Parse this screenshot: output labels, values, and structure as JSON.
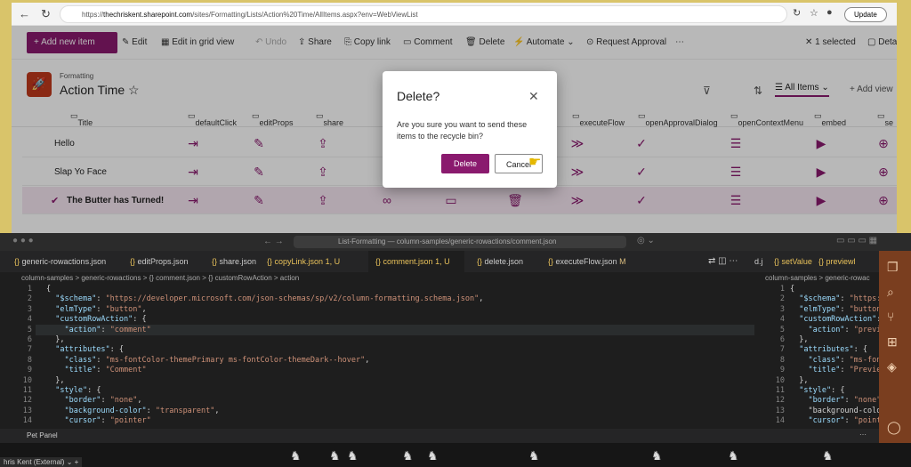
{
  "browser": {
    "url_prefix": "https://",
    "url_host": "thechriskent.sharepoint.com",
    "url_path": "/sites/Formatting/Lists/Action%20Time/AllItems.aspx?env=WebViewList",
    "update_label": "Update"
  },
  "sharepoint": {
    "commands": [
      "Add new item",
      "Edit",
      "Edit in grid view",
      "Undo",
      "Share",
      "Copy link",
      "Comment",
      "Delete",
      "Automate",
      "Request Approval",
      "1 selected",
      "Details"
    ],
    "site_label": "Formatting",
    "list_title": "Action Time",
    "view_label": "All Items",
    "add_view": "Add view",
    "columns": [
      "Title",
      "defaultClick",
      "editProps",
      "share",
      "executeFlow",
      "openApprovalDialog",
      "openContextMenu",
      "embed",
      "se"
    ],
    "rows": [
      {
        "title": "Hello"
      },
      {
        "title": "Slap Yo Face"
      },
      {
        "title": "The Butter has Turned!"
      }
    ]
  },
  "dialog": {
    "title": "Delete?",
    "message": "Are you sure you want to send these items to the recycle bin?",
    "delete_label": "Delete",
    "cancel_label": "Cancel"
  },
  "vscode": {
    "command_center": "List-Formatting — column-samples/generic-rowactions/comment.json",
    "tabs": [
      {
        "name": "generic-rowactions.json",
        "badge": ""
      },
      {
        "name": "editProps.json",
        "badge": ""
      },
      {
        "name": "share.json",
        "badge": ""
      },
      {
        "name": "copyLink.json",
        "badge": "1, U"
      },
      {
        "name": "comment.json",
        "badge": "1, U"
      },
      {
        "name": "delete.json",
        "badge": ""
      },
      {
        "name": "executeFlow.json",
        "badge": "M"
      }
    ],
    "tabs_right": [
      "d.j",
      "setValue",
      "previewl"
    ],
    "breadcrumb": "column-samples > generic-rowactions > {} comment.json > {} customRowAction > action",
    "breadcrumb_right": "column-samples > generic-rowac",
    "code_lines": [
      "{",
      "  \"$schema\": \"https://developer.microsoft.com/json-schemas/sp/v2/column-formatting.schema.json\",",
      "  \"elmType\": \"button\",",
      "  \"customRowAction\": {",
      "    \"action\": \"comment\"",
      "  },",
      "  \"attributes\": {",
      "    \"class\": \"ms-fontColor-themePrimary ms-fontColor-themeDark--hover\",",
      "    \"title\": \"Comment\"",
      "  },",
      "  \"style\": {",
      "    \"border\": \"none\",",
      "    \"background-color\": \"transparent\",",
      "    \"cursor\": \"pointer\""
    ],
    "code_lines_right": [
      "{",
      "  \"$schema\": \"https:/",
      "  \"elmType\": \"button\"",
      "  \"customRowAction\": {",
      "    \"action\": \"preview",
      "  },",
      "  \"attributes\": {",
      "    \"class\": \"ms-font",
      "    \"title\": \"Preview",
      "  },",
      "  \"style\": {",
      "    \"border\": \"none\",",
      "    \"background-color\"",
      "    \"cursor\": \"pointe"
    ],
    "pet_panel": "Pet Panel",
    "status": "hris Kent (External)"
  }
}
